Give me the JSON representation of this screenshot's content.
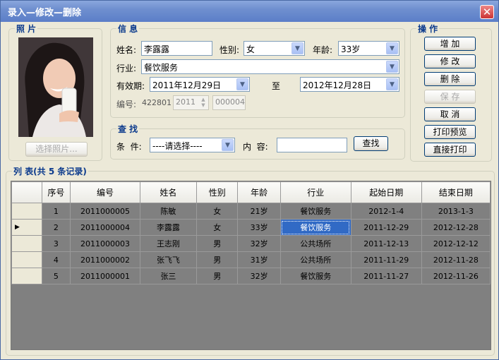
{
  "window": {
    "title": "录入—修改—删除",
    "close": "✕"
  },
  "photo_group": {
    "label": "照 片",
    "select_button": "选择照片..."
  },
  "info": {
    "label": "信 息",
    "name_label": "姓名:",
    "name_value": "李露露",
    "gender_label": "性别:",
    "gender_value": "女",
    "age_label": "年龄:",
    "age_value": "33岁",
    "industry_label": "行业:",
    "industry_value": "餐饮服务",
    "valid_label": "有效期:",
    "valid_from": "2011年12月29日",
    "to_label": "至",
    "valid_to": "2012年12月28日",
    "code_label": "编号:",
    "code_prefix": "422801",
    "code_year": "2011",
    "code_seq": "000004"
  },
  "search": {
    "label": "查 找",
    "cond_label": "条  件:",
    "cond_value": "----请选择----",
    "content_label": "内  容:",
    "content_value": "",
    "find_button": "查找"
  },
  "ops": {
    "label": "操 作",
    "add": "增 加",
    "edit": "修 改",
    "delete": "删 除",
    "save": "保 存",
    "cancel": "取 消",
    "print_preview": "打印预览",
    "print_direct": "直接打印"
  },
  "list": {
    "label": "列 表(共 5 条记录)",
    "columns": [
      "序号",
      "编号",
      "姓名",
      "性别",
      "年龄",
      "行业",
      "起始日期",
      "结束日期"
    ],
    "rows": [
      [
        "1",
        "2011000005",
        "陈敏",
        "女",
        "21岁",
        "餐饮服务",
        "2012-1-4",
        "2013-1-3"
      ],
      [
        "2",
        "2011000004",
        "李露露",
        "女",
        "33岁",
        "餐饮服务",
        "2011-12-29",
        "2012-12-28"
      ],
      [
        "3",
        "2011000003",
        "王志刚",
        "男",
        "32岁",
        "公共场所",
        "2011-12-13",
        "2012-12-12"
      ],
      [
        "4",
        "2011000002",
        "张飞飞",
        "男",
        "31岁",
        "公共场所",
        "2011-11-29",
        "2012-11-28"
      ],
      [
        "5",
        "2011000001",
        "张三",
        "男",
        "32岁",
        "餐饮服务",
        "2011-11-27",
        "2012-11-26"
      ]
    ],
    "selected_row_marker": "▶"
  }
}
